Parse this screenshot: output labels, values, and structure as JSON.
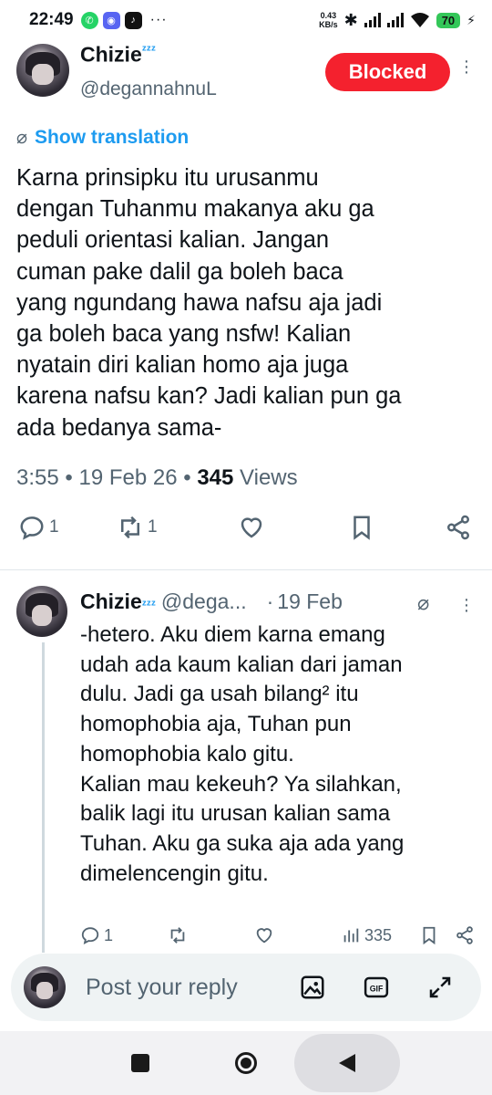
{
  "status_bar": {
    "time": "22:49",
    "apps": [
      "whatsapp-icon",
      "discord-icon",
      "tiktok-icon"
    ],
    "more": "···",
    "net_speed_value": "0.43",
    "net_speed_unit": "KB/s",
    "battery": "70"
  },
  "tweet": {
    "author_name": "Chizie",
    "author_badge": "ᶻᶻᶻ",
    "handle": "@degannahnuL",
    "follow_state": "Blocked",
    "translate_label": "Show translation",
    "text": "Karna prinsipku itu urusanmu\ndengan Tuhanmu makanya aku ga\npeduli orientasi kalian. Jangan\ncuman pake dalil ga boleh baca\nyang ngundang hawa nafsu aja jadi\nga boleh baca yang nsfw! Kalian\nnyatain diri kalian homo aja juga\nkarena nafsu kan? Jadi kalian pun ga\nada bedanya sama-",
    "time": "3:55",
    "date": "19 Feb 26",
    "views_count": "345",
    "views_label": "Views",
    "replies": "1",
    "reposts": "1"
  },
  "reply": {
    "author_name": "Chizie",
    "author_badge": "ᶻᶻᶻ",
    "handle": "@dega...",
    "date": "19 Feb",
    "text": "-hetero. Aku diem karna emang\nudah ada kaum kalian dari jaman\ndulu. Jadi ga usah bilang² itu\nhomophobia aja, Tuhan pun\nhomophobia kalo gitu.\nKalian mau kekeuh? Ya silahkan,\nbalik lagi itu urusan kalian sama\nTuhan. Aku ga suka aja ada yang\ndimelencengin gitu.",
    "replies": "1",
    "views": "335"
  },
  "composer": {
    "placeholder": "Post your reply",
    "gif_label": "GIF"
  },
  "colors": {
    "accent": "#1d9bf0",
    "blocked": "#f4212e",
    "secondary_text": "#536471",
    "battery": "#34c759"
  }
}
